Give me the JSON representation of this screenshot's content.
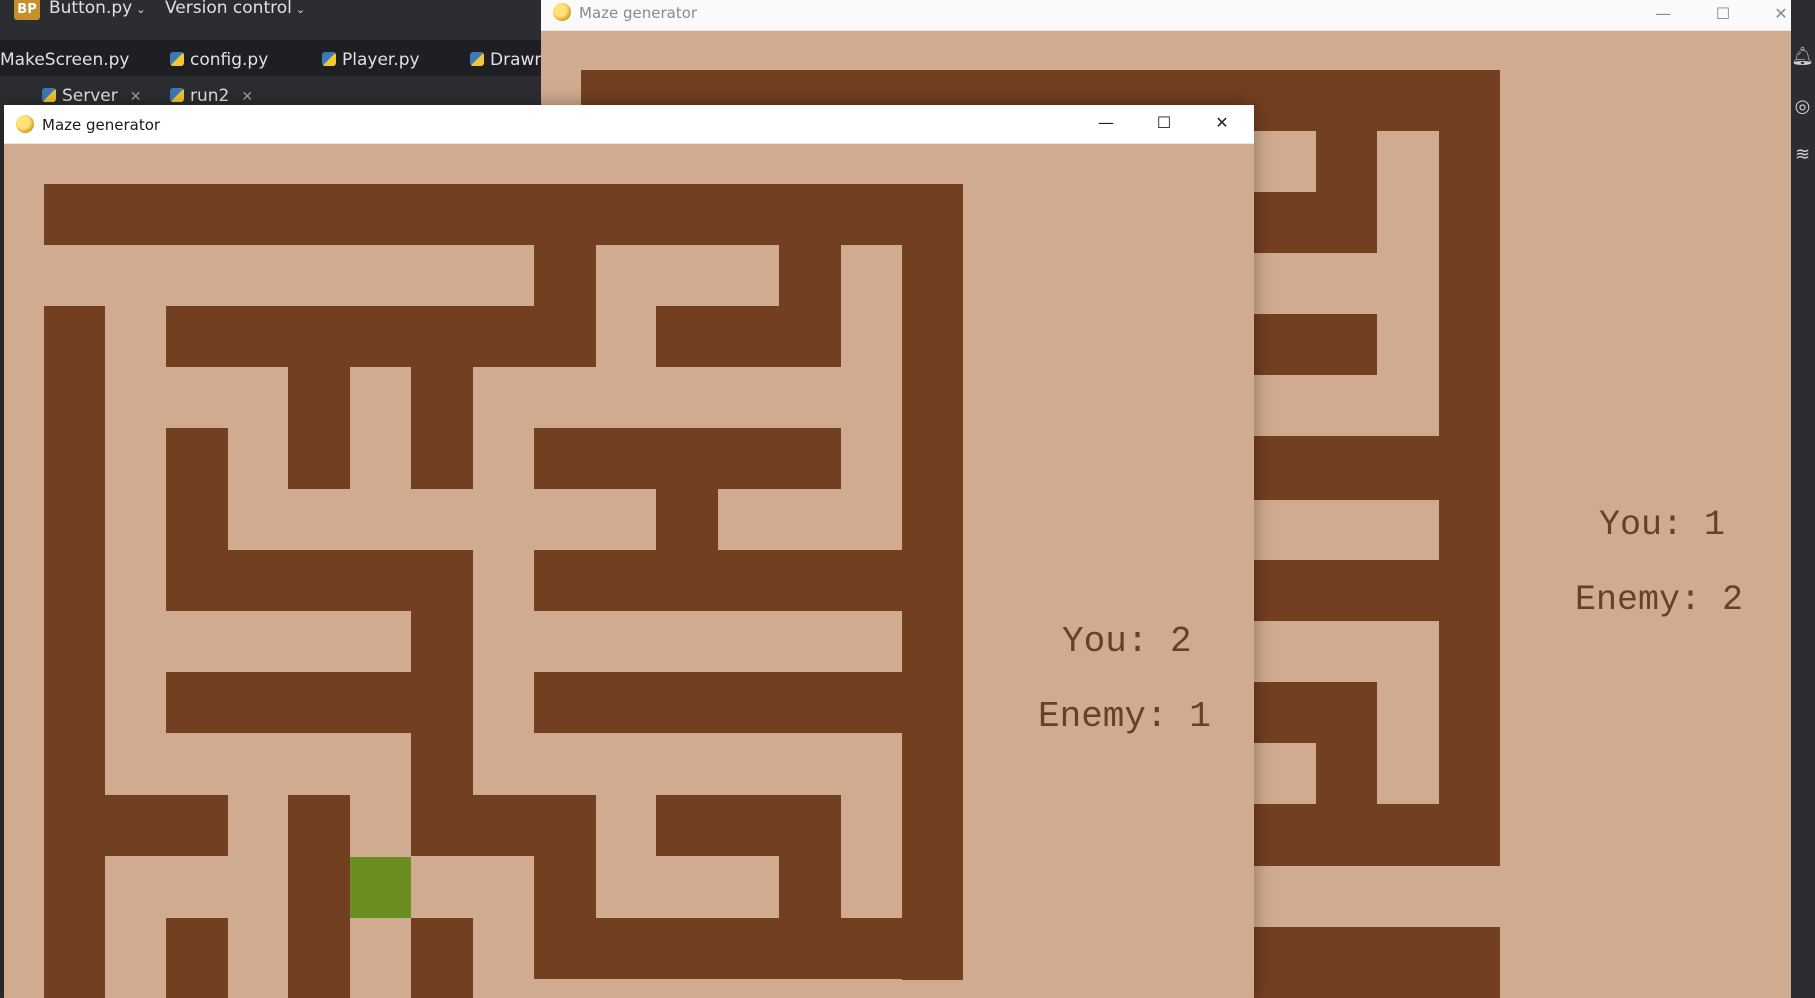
{
  "ide": {
    "project_badge": "BP",
    "project_name": "Button.py",
    "vcs_menu": "Version control",
    "file_tabs": [
      "MakeScreen.py",
      "config.py",
      "Player.py",
      "Drawn"
    ],
    "run_tabs": [
      "Server",
      "run2"
    ]
  },
  "back_window": {
    "title": "Maze generator",
    "score_you": "You: 1",
    "score_enemy": "Enemy: 2"
  },
  "front_window": {
    "title": "Maze generator",
    "score_you": "You: 2",
    "score_enemy": "Enemy: 1"
  },
  "window_controls": {
    "minimize": "—",
    "maximize": "☐",
    "close": "✕"
  },
  "colors": {
    "floor": "#d0ab8f",
    "wall": "#733f21",
    "player": "#6b8e23",
    "score_text": "#6a3f24"
  }
}
